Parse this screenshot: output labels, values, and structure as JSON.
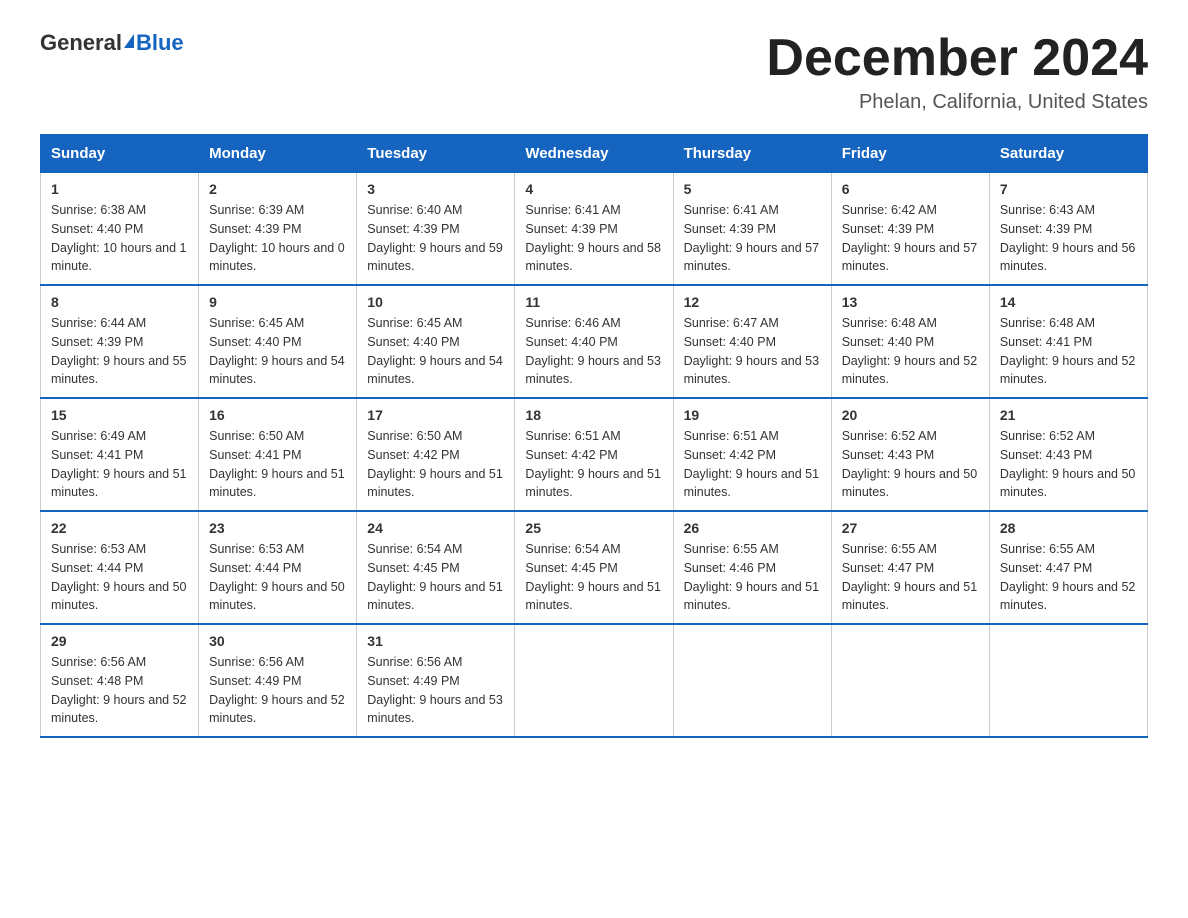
{
  "header": {
    "logo_general": "General",
    "logo_blue": "Blue",
    "month_title": "December 2024",
    "location": "Phelan, California, United States"
  },
  "days_of_week": [
    "Sunday",
    "Monday",
    "Tuesday",
    "Wednesday",
    "Thursday",
    "Friday",
    "Saturday"
  ],
  "weeks": [
    [
      {
        "date": "1",
        "sunrise": "6:38 AM",
        "sunset": "4:40 PM",
        "daylight": "10 hours and 1 minute."
      },
      {
        "date": "2",
        "sunrise": "6:39 AM",
        "sunset": "4:39 PM",
        "daylight": "10 hours and 0 minutes."
      },
      {
        "date": "3",
        "sunrise": "6:40 AM",
        "sunset": "4:39 PM",
        "daylight": "9 hours and 59 minutes."
      },
      {
        "date": "4",
        "sunrise": "6:41 AM",
        "sunset": "4:39 PM",
        "daylight": "9 hours and 58 minutes."
      },
      {
        "date": "5",
        "sunrise": "6:41 AM",
        "sunset": "4:39 PM",
        "daylight": "9 hours and 57 minutes."
      },
      {
        "date": "6",
        "sunrise": "6:42 AM",
        "sunset": "4:39 PM",
        "daylight": "9 hours and 57 minutes."
      },
      {
        "date": "7",
        "sunrise": "6:43 AM",
        "sunset": "4:39 PM",
        "daylight": "9 hours and 56 minutes."
      }
    ],
    [
      {
        "date": "8",
        "sunrise": "6:44 AM",
        "sunset": "4:39 PM",
        "daylight": "9 hours and 55 minutes."
      },
      {
        "date": "9",
        "sunrise": "6:45 AM",
        "sunset": "4:40 PM",
        "daylight": "9 hours and 54 minutes."
      },
      {
        "date": "10",
        "sunrise": "6:45 AM",
        "sunset": "4:40 PM",
        "daylight": "9 hours and 54 minutes."
      },
      {
        "date": "11",
        "sunrise": "6:46 AM",
        "sunset": "4:40 PM",
        "daylight": "9 hours and 53 minutes."
      },
      {
        "date": "12",
        "sunrise": "6:47 AM",
        "sunset": "4:40 PM",
        "daylight": "9 hours and 53 minutes."
      },
      {
        "date": "13",
        "sunrise": "6:48 AM",
        "sunset": "4:40 PM",
        "daylight": "9 hours and 52 minutes."
      },
      {
        "date": "14",
        "sunrise": "6:48 AM",
        "sunset": "4:41 PM",
        "daylight": "9 hours and 52 minutes."
      }
    ],
    [
      {
        "date": "15",
        "sunrise": "6:49 AM",
        "sunset": "4:41 PM",
        "daylight": "9 hours and 51 minutes."
      },
      {
        "date": "16",
        "sunrise": "6:50 AM",
        "sunset": "4:41 PM",
        "daylight": "9 hours and 51 minutes."
      },
      {
        "date": "17",
        "sunrise": "6:50 AM",
        "sunset": "4:42 PM",
        "daylight": "9 hours and 51 minutes."
      },
      {
        "date": "18",
        "sunrise": "6:51 AM",
        "sunset": "4:42 PM",
        "daylight": "9 hours and 51 minutes."
      },
      {
        "date": "19",
        "sunrise": "6:51 AM",
        "sunset": "4:42 PM",
        "daylight": "9 hours and 51 minutes."
      },
      {
        "date": "20",
        "sunrise": "6:52 AM",
        "sunset": "4:43 PM",
        "daylight": "9 hours and 50 minutes."
      },
      {
        "date": "21",
        "sunrise": "6:52 AM",
        "sunset": "4:43 PM",
        "daylight": "9 hours and 50 minutes."
      }
    ],
    [
      {
        "date": "22",
        "sunrise": "6:53 AM",
        "sunset": "4:44 PM",
        "daylight": "9 hours and 50 minutes."
      },
      {
        "date": "23",
        "sunrise": "6:53 AM",
        "sunset": "4:44 PM",
        "daylight": "9 hours and 50 minutes."
      },
      {
        "date": "24",
        "sunrise": "6:54 AM",
        "sunset": "4:45 PM",
        "daylight": "9 hours and 51 minutes."
      },
      {
        "date": "25",
        "sunrise": "6:54 AM",
        "sunset": "4:45 PM",
        "daylight": "9 hours and 51 minutes."
      },
      {
        "date": "26",
        "sunrise": "6:55 AM",
        "sunset": "4:46 PM",
        "daylight": "9 hours and 51 minutes."
      },
      {
        "date": "27",
        "sunrise": "6:55 AM",
        "sunset": "4:47 PM",
        "daylight": "9 hours and 51 minutes."
      },
      {
        "date": "28",
        "sunrise": "6:55 AM",
        "sunset": "4:47 PM",
        "daylight": "9 hours and 52 minutes."
      }
    ],
    [
      {
        "date": "29",
        "sunrise": "6:56 AM",
        "sunset": "4:48 PM",
        "daylight": "9 hours and 52 minutes."
      },
      {
        "date": "30",
        "sunrise": "6:56 AM",
        "sunset": "4:49 PM",
        "daylight": "9 hours and 52 minutes."
      },
      {
        "date": "31",
        "sunrise": "6:56 AM",
        "sunset": "4:49 PM",
        "daylight": "9 hours and 53 minutes."
      },
      null,
      null,
      null,
      null
    ]
  ]
}
